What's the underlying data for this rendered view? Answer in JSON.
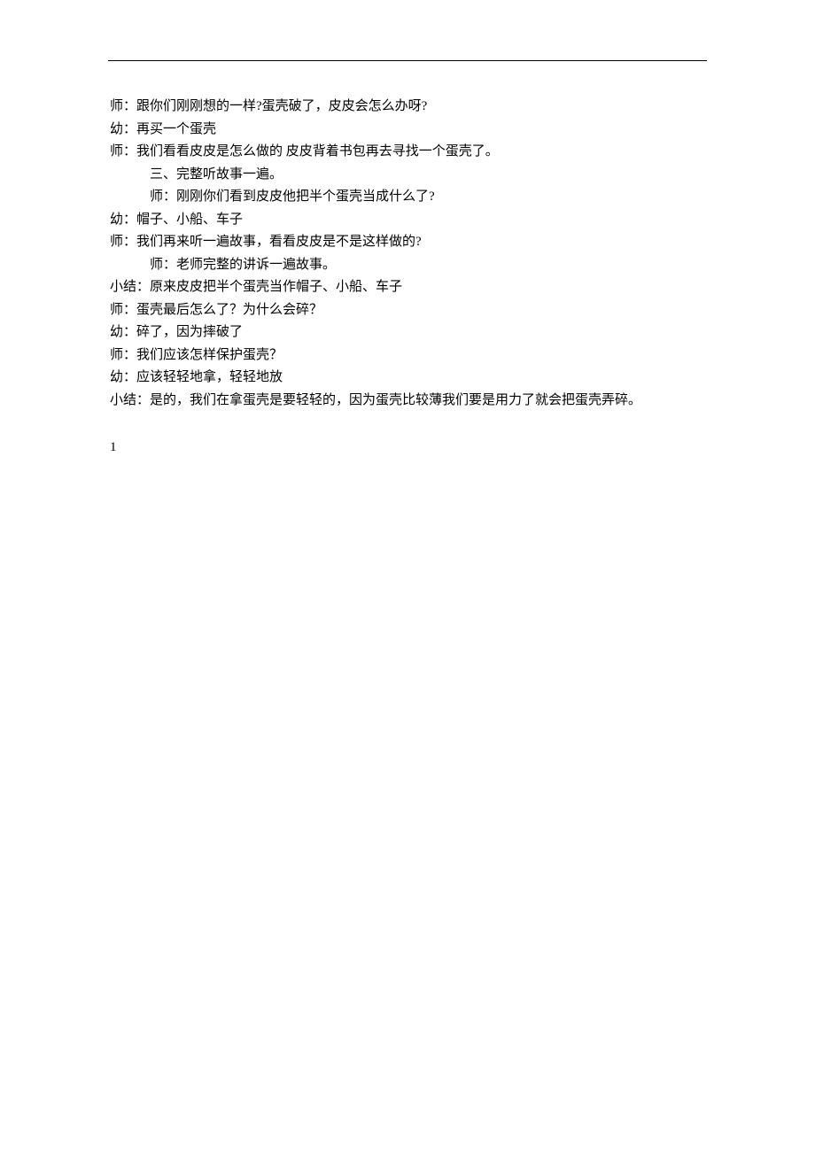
{
  "lines": [
    {
      "cls": "line",
      "text": "师：跟你们刚刚想的一样?蛋壳破了，皮皮会怎么办呀?"
    },
    {
      "cls": "line",
      "text": "幼：再买一个蛋壳"
    },
    {
      "cls": "line",
      "text": "师：我们看看皮皮是怎么做的 皮皮背着书包再去寻找一个蛋壳了。"
    },
    {
      "cls": "line indent1",
      "text": "三、完整听故事一遍。"
    },
    {
      "cls": "line indent2",
      "text": "师：刚刚你们看到皮皮他把半个蛋壳当成什么了?"
    },
    {
      "cls": "line",
      "text": "幼：帽子、小船、车子"
    },
    {
      "cls": "line",
      "text": "师：我们再来听一遍故事，看看皮皮是不是这样做的?"
    },
    {
      "cls": "line indent2",
      "text": "师：老师完整的讲诉一遍故事。"
    },
    {
      "cls": "line",
      "text": "小结：原来皮皮把半个蛋壳当作帽子、小船、车子"
    },
    {
      "cls": "line",
      "text": "师：蛋壳最后怎么了？为什么会碎？"
    },
    {
      "cls": "line",
      "text": "幼：碎了，因为摔破了"
    },
    {
      "cls": "line",
      "text": "师：我们应该怎样保护蛋壳？"
    },
    {
      "cls": "line",
      "text": "幼：应该轻轻地拿，轻轻地放"
    },
    {
      "cls": "line",
      "text": "小结：是的，我们在拿蛋壳是要轻轻的，因为蛋壳比较薄我们要是用力了就会把蛋壳弄碎。"
    }
  ],
  "footer": "1"
}
